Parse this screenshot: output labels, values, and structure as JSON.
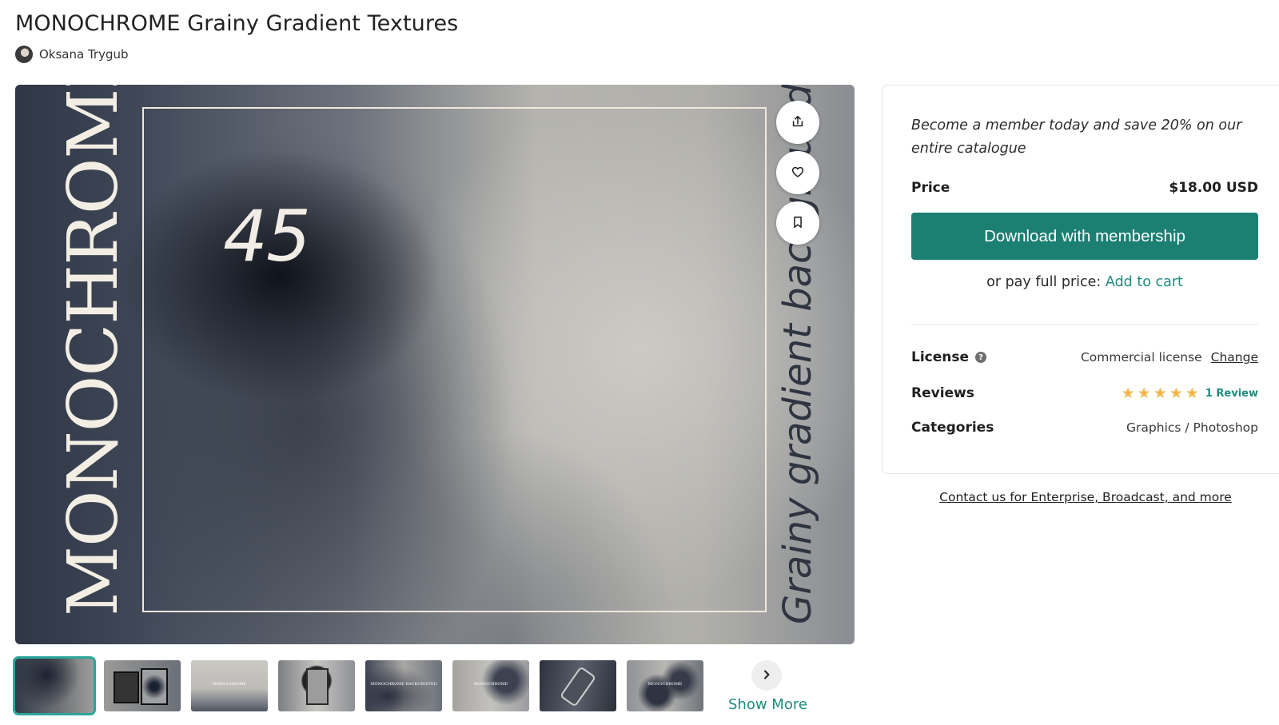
{
  "product": {
    "title": "MONOCHROME Grainy Gradient Textures",
    "author": "Oksana Trygub"
  },
  "hero": {
    "brand_text": "MONOCHROME",
    "number_text": "45",
    "tagline": "Grainy gradient background",
    "actions": [
      "share-icon",
      "heart-icon",
      "bookmark-icon"
    ]
  },
  "thumbnails": {
    "labels": [
      "",
      "",
      "MONOCHROME",
      "",
      "MONOCHROME BACKGROUND",
      "MONOCHROME",
      "",
      "MONOCHROME"
    ],
    "show_more": "Show More",
    "next_icon": "chevron-right-icon"
  },
  "panel": {
    "promo": "Become a member today and save 20% on our entire catalogue",
    "price_label": "Price",
    "price_value": "$18.00 USD",
    "download_label": "Download with membership",
    "alt_price_prefix": "or pay full price:",
    "add_to_cart": "Add to cart",
    "license_label": "License",
    "license_value": "Commercial license",
    "change_label": "Change",
    "reviews_label": "Reviews",
    "rating": 5,
    "review_count": "1 Review",
    "categories_label": "Categories",
    "categories_value": "Graphics / Photoshop",
    "contact_link": "Contact us for Enterprise, Broadcast, and more"
  },
  "colors": {
    "accent": "#1b7f72",
    "link": "#1f8b7f",
    "star": "#f2b749"
  }
}
